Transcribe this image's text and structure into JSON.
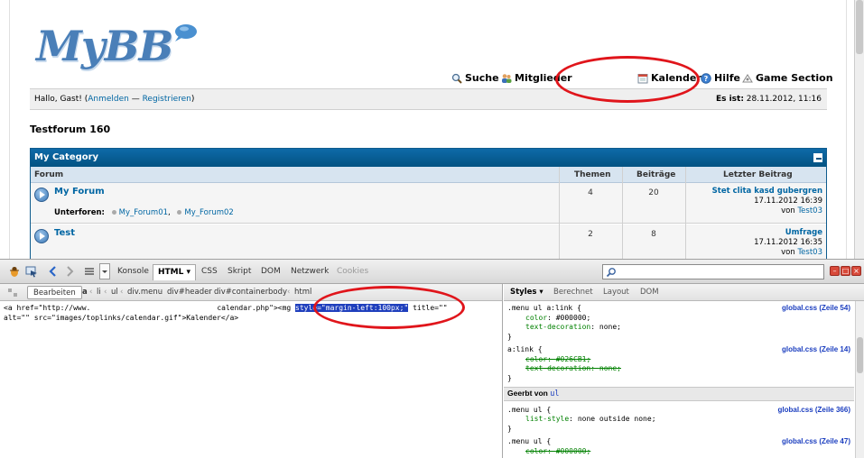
{
  "logo": {
    "text": "MyBB"
  },
  "toplinks": [
    {
      "label": "Suche",
      "icon": "search-icon"
    },
    {
      "label": "Mitglieder",
      "icon": "members-icon"
    },
    {
      "label": "Kalender",
      "icon": "calendar-icon"
    },
    {
      "label": "Hilfe",
      "icon": "help-icon"
    },
    {
      "label": "Game Section",
      "icon": "game-icon"
    }
  ],
  "welcome": {
    "greeting": "Hallo, Gast! (",
    "login": "Anmelden",
    "dash": " — ",
    "register": "Registrieren",
    "close": ")",
    "date_label": "Es ist:",
    "date_value": "28.11.2012, 11:16"
  },
  "forum_title": "Testforum 160",
  "category": {
    "name": "My Category",
    "columns": {
      "forum": "Forum",
      "topics": "Themen",
      "posts": "Beiträge",
      "last": "Letzter Beitrag"
    },
    "rows": [
      {
        "name": "My Forum",
        "subforums_label": "Unterforen:",
        "subforums": [
          "My_Forum01",
          "My_Forum02"
        ],
        "topics": "4",
        "posts": "20",
        "last_title": "Stet clita kasd gubergren",
        "last_date": "17.11.2012 16:39",
        "last_by_label": "von",
        "last_by": "Test03"
      },
      {
        "name": "Test",
        "topics": "2",
        "posts": "8",
        "last_title": "Umfrage",
        "last_date": "17.11.2012 16:35",
        "last_by_label": "von",
        "last_by": "Test03"
      }
    ]
  },
  "devtools": {
    "tabs": [
      "Konsole",
      "HTML",
      "CSS",
      "Skript",
      "DOM",
      "Netzwerk",
      "Cookies"
    ],
    "edit_button": "Bearbeiten",
    "breadcrumb": [
      "a",
      "li",
      "ul",
      "div.menu",
      "div#header",
      "div#container",
      "body",
      "html"
    ],
    "code_line1_a": "<a href=\"http://www.",
    "code_line1_b": "calendar.php\"><",
    "code_line1_c": "mg ",
    "code_line1_hl": "style=\"margin-left:100px;\"",
    "code_line1_d": " title=\"\"",
    "code_line2": "alt=\"\" src=\"images/toplinks/calendar.gif\">Kalender</a>",
    "side_tabs": [
      "Styles",
      "Berechnet",
      "Layout",
      "DOM"
    ],
    "rules": [
      {
        "selector": ".menu ul a:link {",
        "source": "global.css (Zeile 54)",
        "props": [
          {
            "name": "color",
            "value": "#000000;",
            "struck": false
          },
          {
            "name": "text-decoration",
            "value": "none;",
            "struck": false
          }
        ]
      },
      {
        "selector": "a:link {",
        "source": "global.css (Zeile 14)",
        "props": [
          {
            "name": "color",
            "value": "#026CB1;",
            "struck": true
          },
          {
            "name": "text-decoration",
            "value": "none;",
            "struck": true
          }
        ]
      },
      {
        "selector": ".menu ul {",
        "source": "global.css (Zeile 366)",
        "props": [
          {
            "name": "list-style",
            "value": "none outside none;",
            "struck": false
          }
        ]
      },
      {
        "selector": ".menu ul {",
        "source": "global.css (Zeile 47)",
        "props": [
          {
            "name": "color",
            "value": "#000000;",
            "struck": true
          }
        ]
      }
    ],
    "inherited_label": "Geerbt von",
    "inherited_from": "ul",
    "close_brace": "}"
  },
  "colors": {
    "accent": "#025282",
    "link": "#0066a3",
    "annotation": "#e0151b",
    "highlight": "#1f3fbd"
  }
}
